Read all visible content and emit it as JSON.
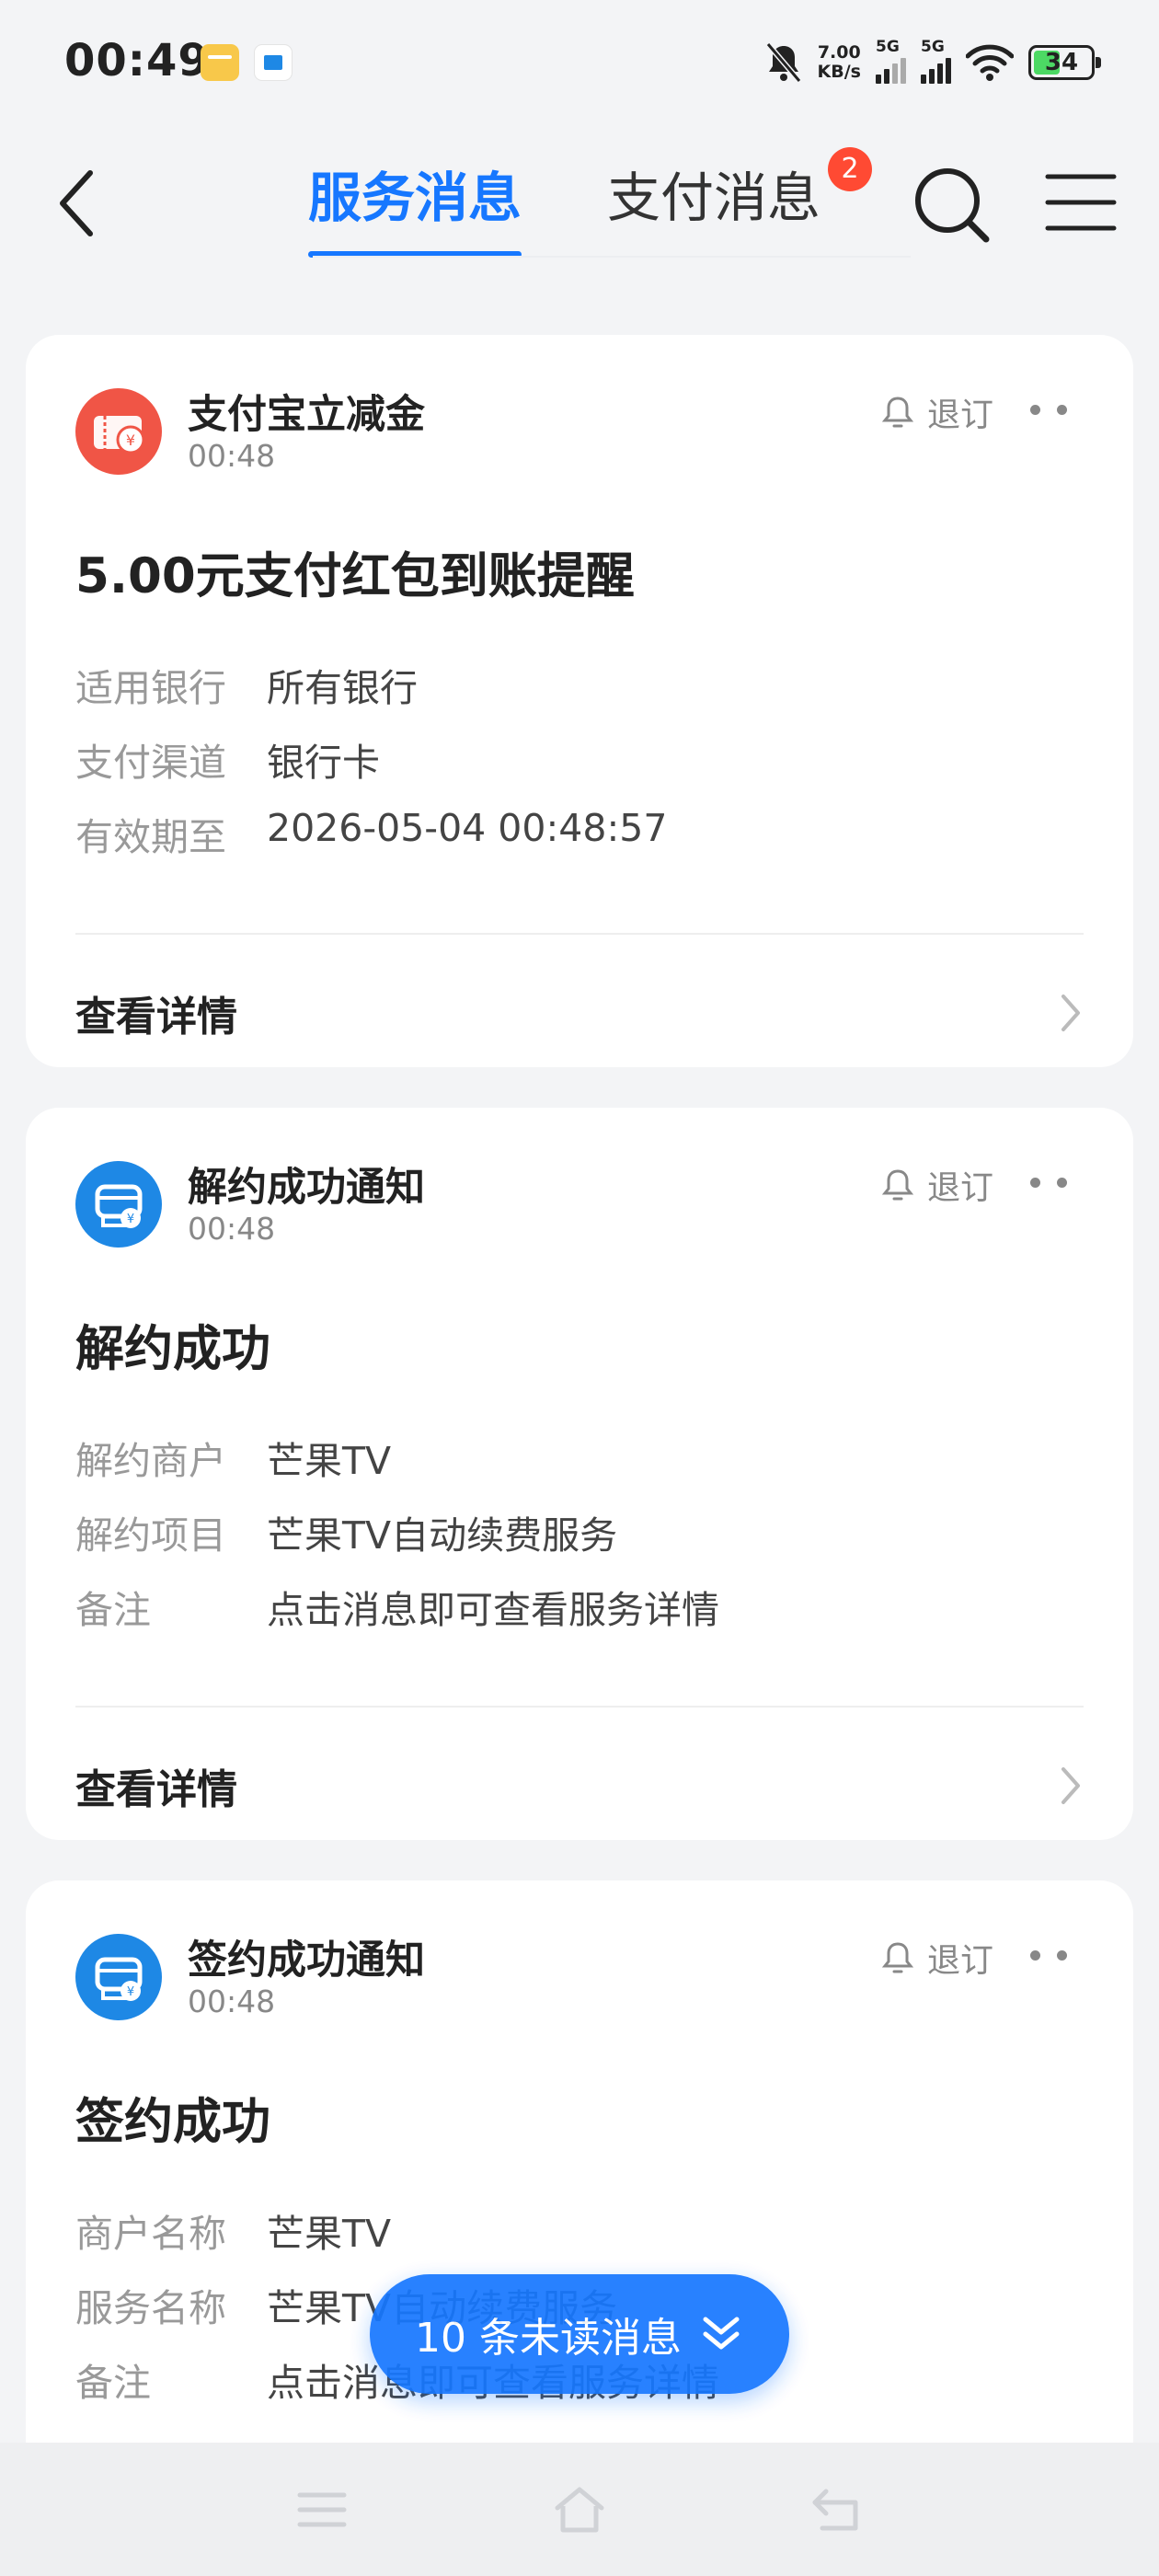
{
  "status_bar": {
    "time": "00:49",
    "net_speed_value": "7.00",
    "net_speed_unit": "KB/s",
    "sim1": "5G",
    "sim2": "5G",
    "battery": "34"
  },
  "header": {
    "tabs": [
      {
        "label": "服务消息",
        "active": true
      },
      {
        "label": "支付消息",
        "active": false,
        "badge": "2"
      }
    ],
    "icons": [
      "back-arrow-icon",
      "search-icon",
      "menu-icon"
    ]
  },
  "cards": [
    {
      "sender": "支付宝立减金",
      "time": "00:48",
      "avatar": "red-coupon-icon",
      "unsubscribe": "退订",
      "title": "5.00元支付红包到账提醒",
      "rows": [
        {
          "key": "适用银行",
          "value": "所有银行"
        },
        {
          "key": "支付渠道",
          "value": "银行卡"
        },
        {
          "key": "有效期至",
          "value": "2026-05-04 00:48:57"
        }
      ],
      "detail_label": "查看详情"
    },
    {
      "sender": "解约成功通知",
      "time": "00:48",
      "avatar": "blue-contract-icon",
      "unsubscribe": "退订",
      "title": "解约成功",
      "rows": [
        {
          "key": "解约商户",
          "value": "芒果TV"
        },
        {
          "key": "解约项目",
          "value": "芒果TV自动续费服务"
        },
        {
          "key": "备注",
          "value": "点击消息即可查看服务详情"
        }
      ],
      "detail_label": "查看详情"
    },
    {
      "sender": "签约成功通知",
      "time": "00:48",
      "avatar": "blue-contract-icon",
      "unsubscribe": "退订",
      "title": "签约成功",
      "rows": [
        {
          "key": "商户名称",
          "value": "芒果TV"
        },
        {
          "key": "服务名称",
          "value": "芒果TV自动续费服务"
        },
        {
          "key": "备注",
          "value": "点击消息即可查看服务详情"
        }
      ]
    }
  ],
  "unread_button": {
    "label": "10 条未读消息"
  },
  "colors": {
    "accent": "#1677ff",
    "badge": "#ff4a33",
    "coupon_red": "#f05546",
    "contract_blue": "#1e88e5"
  }
}
